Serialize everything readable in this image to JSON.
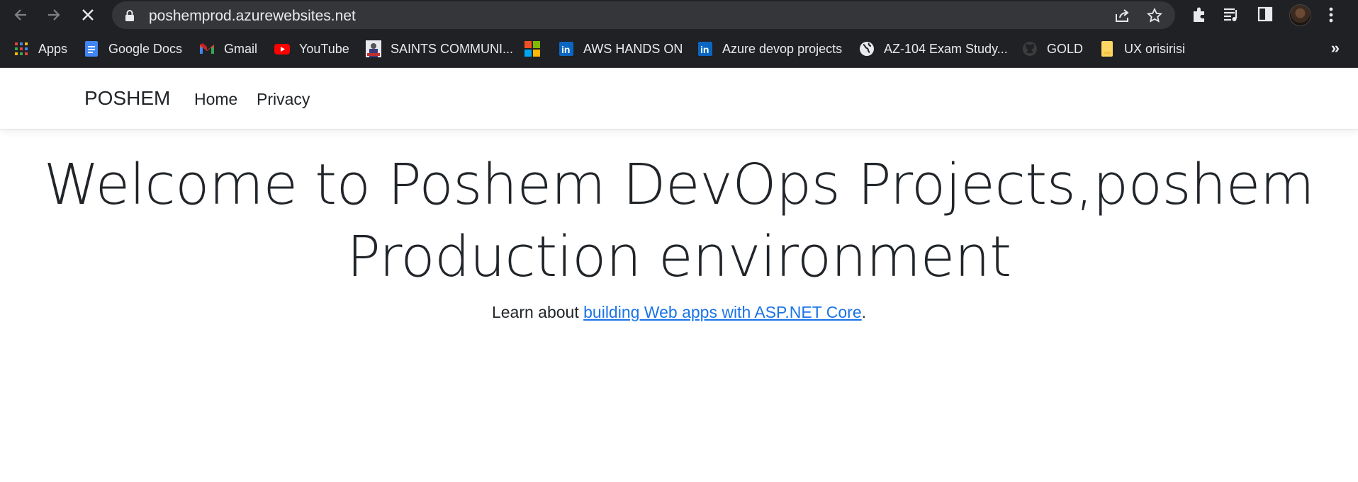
{
  "browser": {
    "url": "poshemprod.azurewebsites.net",
    "icons": {
      "back": "back-arrow-icon",
      "forward": "forward-arrow-icon",
      "stop": "close-icon",
      "lock": "lock-icon",
      "share": "share-icon",
      "bookmark": "star-icon",
      "extensions": "puzzle-icon",
      "reading_list": "reading-list-icon",
      "side_panel": "side-panel-icon",
      "menu": "kebab-menu-icon"
    },
    "bookmarks": [
      {
        "label": "Apps",
        "icon": "apps-grid-icon"
      },
      {
        "label": "Google Docs",
        "icon": "google-docs-icon"
      },
      {
        "label": "Gmail",
        "icon": "gmail-icon"
      },
      {
        "label": "YouTube",
        "icon": "youtube-icon"
      },
      {
        "label": "SAINTS COMMUNI...",
        "icon": "saints-icon"
      },
      {
        "label": "",
        "icon": "microsoft-icon"
      },
      {
        "label": "AWS HANDS ON",
        "icon": "linkedin-icon"
      },
      {
        "label": "Azure devop projects",
        "icon": "linkedin-icon"
      },
      {
        "label": "AZ-104 Exam Study...",
        "icon": "globe-icon"
      },
      {
        "label": "GOLD",
        "icon": "github-icon"
      },
      {
        "label": "UX orisirisi",
        "icon": "folder-icon"
      }
    ],
    "more_label": "»"
  },
  "site": {
    "brand": "POSHEM",
    "nav": {
      "home": "Home",
      "privacy": "Privacy"
    },
    "hero": {
      "title_line1": "Welcome to Poshem DevOps Projects,poshem",
      "title_line2": "Production environment",
      "learn_prefix": "Learn about ",
      "learn_link": "building Web apps with ASP.NET Core",
      "learn_suffix": "."
    }
  },
  "colors": {
    "chrome_bg": "#202124",
    "omnibox_bg": "#35363a",
    "link": "#1a73e8",
    "text": "#212529"
  }
}
